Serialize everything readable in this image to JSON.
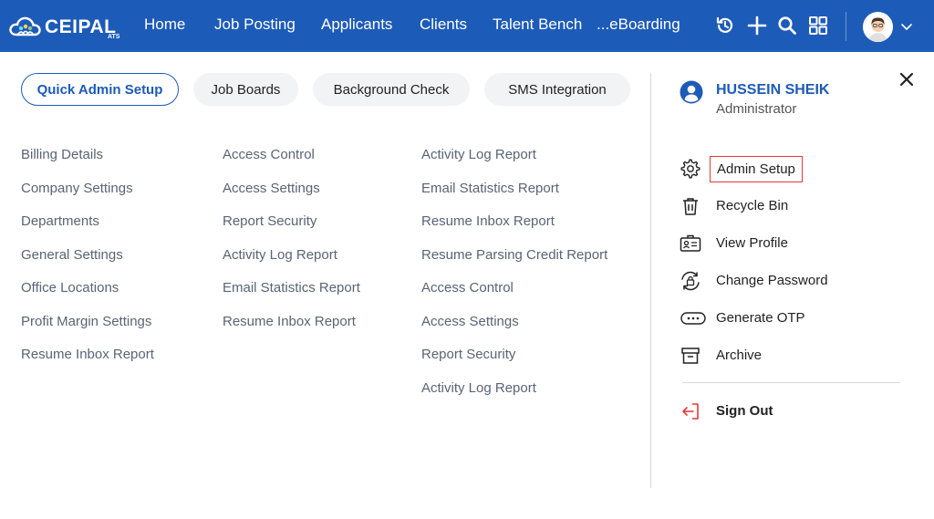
{
  "brand": {
    "name": "CEIPAL",
    "sub": "ATS"
  },
  "nav": {
    "items": [
      {
        "label": "Home"
      },
      {
        "label": "Job Posting"
      },
      {
        "label": "Applicants"
      },
      {
        "label": "Clients"
      },
      {
        "label": "Talent Bench"
      },
      {
        "label": "...eBoarding"
      }
    ]
  },
  "toolbar": {
    "icons": [
      "recent-activity-icon",
      "add-icon",
      "search-icon",
      "apps-grid-icon",
      "avatar",
      "chevron-down-icon"
    ]
  },
  "tabs": [
    {
      "label": "Quick Admin Setup",
      "active": true
    },
    {
      "label": "Job Boards",
      "active": false
    },
    {
      "label": "Background Check",
      "active": false
    },
    {
      "label": "SMS Integration",
      "active": false
    }
  ],
  "columns": [
    [
      "Billing Details",
      "Company Settings",
      "Departments",
      "General Settings",
      "Office Locations",
      "Profit Margin Settings",
      "Resume Inbox Report"
    ],
    [
      "Access Control",
      "Access Settings",
      "Report Security",
      "Activity Log Report",
      "Email Statistics Report",
      "Resume Inbox Report"
    ],
    [
      "Activity Log Report",
      "Email Statistics Report",
      "Resume Inbox Report",
      "Resume Parsing Credit Report",
      "Access Control",
      "Access Settings",
      "Report Security",
      "Activity Log Report"
    ]
  ],
  "profile": {
    "name": "HUSSEIN SHEIK",
    "role": "Administrator",
    "menu": [
      {
        "label": "Admin Setup",
        "icon": "gear-icon"
      },
      {
        "label": "Recycle Bin",
        "icon": "trash-icon"
      },
      {
        "label": "View Profile",
        "icon": "id-card-icon"
      },
      {
        "label": "Change Password",
        "icon": "lock-refresh-icon"
      },
      {
        "label": "Generate OTP",
        "icon": "otp-icon"
      },
      {
        "label": "Archive",
        "icon": "archive-icon"
      }
    ],
    "signout": {
      "label": "Sign Out",
      "icon": "sign-out-icon"
    }
  },
  "colors": {
    "primary": "#1d5bb8",
    "highlight": "#e53935",
    "muted": "#5a6475"
  }
}
